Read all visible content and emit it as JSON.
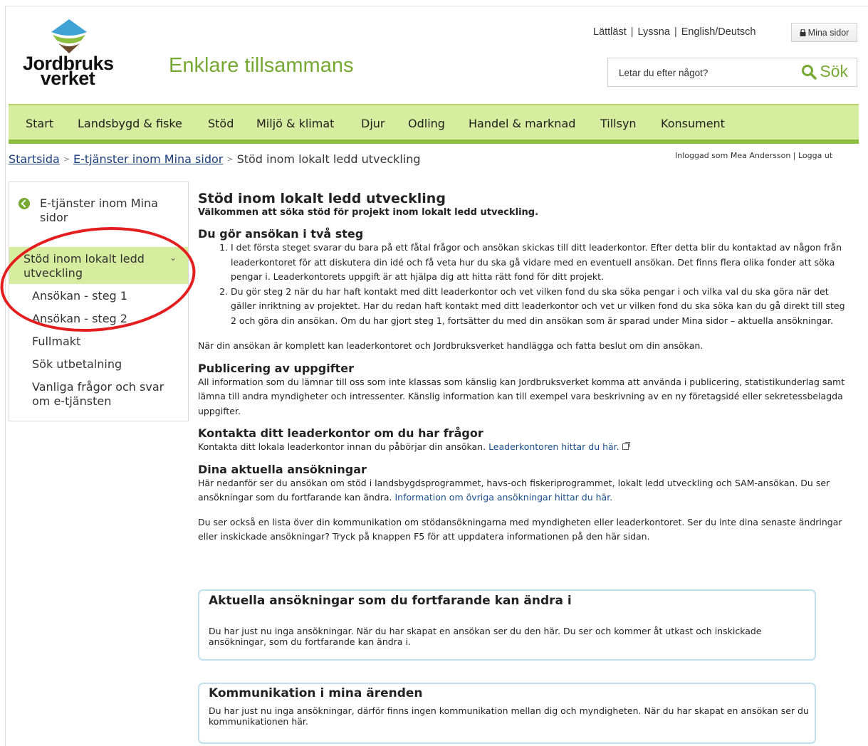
{
  "header": {
    "logo_line1": "Jordbruks",
    "logo_line2": "verket",
    "tagline": "Enklare tillsammans",
    "links": [
      "Lättläst",
      "Lyssna",
      "English/Deutsch"
    ],
    "mina_sidor_label": "Mina sidor",
    "search_placeholder": "Letar du efter något?",
    "search_button": "Sök"
  },
  "nav": [
    "Start",
    "Landsbygd & fiske",
    "Stöd",
    "Miljö & klimat",
    "Djur",
    "Odling",
    "Handel & marknad",
    "Tillsyn",
    "Konsument"
  ],
  "breadcrumb": {
    "home": "Startsida",
    "level1": "E-tjänster inom Mina sidor",
    "current": "Stöd inom lokalt ledd utveckling"
  },
  "user": {
    "logged_in_text": "Inloggad som Mea Andersson",
    "logout": "Logga ut"
  },
  "sidebar": {
    "back": "E-tjänster inom Mina sidor",
    "active": "Stöd inom lokalt ledd utveckling",
    "items": [
      "Ansökan - steg 1",
      "Ansökan - steg 2",
      "Fullmakt",
      "Sök utbetalning",
      "Vanliga frågor och svar om e-tjänsten"
    ]
  },
  "main": {
    "title": "Stöd inom lokalt ledd utveckling",
    "intro": "Välkommen att söka stöd för projekt inom lokalt ledd utveckling.",
    "steps_heading": "Du gör ansökan i två steg",
    "step1": "I det första steget svarar du bara på ett fåtal frågor och ansökan skickas till ditt leaderkontor. Efter detta blir du kontaktad av någon från leaderkontoret för att diskutera din idé och få veta hur du ska gå vidare med en eventuell ansökan. Det finns flera olika fonder att söka pengar i. Leaderkontorets uppgift är att hjälpa dig att hitta rätt fond för ditt projekt.",
    "step2": "Du gör steg 2 när du har haft kontakt med ditt leaderkontor och vet vilken fond du ska söka pengar i och vilka val du ska göra när det gäller inriktning av projektet. Har du redan haft kontakt med ditt leaderkontor och vet ur vilken fond du ska söka kan du gå direkt till steg 2 och göra din ansökan. Om du har gjort steg 1, fortsätter du med din ansökan som är sparad under Mina sidor – aktuella ansökningar.",
    "complete_text": "När din ansökan är komplett kan leaderkontoret och Jordbruksverket handlägga och fatta beslut om din ansökan.",
    "pub_heading": "Publicering av uppgifter",
    "pub_text": "All information som du lämnar till oss som inte klassas som känslig kan Jordbruksverket komma att använda i publicering, statistikunderlag samt lämna till andra myndigheter och intressenter. Känslig information kan till exempel vara beskrivning av en ny företagsidé eller sekretessbelagda uppgifter.",
    "contact_heading": "Kontakta ditt leaderkontor om du har frågor",
    "contact_text": "Kontakta ditt lokala leaderkontor innan du påbörjar din ansökan.",
    "contact_link": "Leaderkontoren hittar du här.",
    "current_heading": "Dina aktuella ansökningar",
    "current_text": "Här nedanför ser du ansökan om stöd i landsbygdsprogrammet, havs-och fiskeriprogrammet, lokalt ledd utveckling och SAM-ansökan. Du ser ansökningar som du fortfarande kan ändra.",
    "current_link": "Information om övriga ansökningar hittar du här.",
    "list_text": "Du ser också en lista över din kommunikation om stödansökningarna med myndigheten eller leaderkontoret. Ser du inte dina senaste ändringar eller inskickade ansökningar? Tryck på knappen F5 för att uppdatera informationen på den här sidan."
  },
  "box1": {
    "title": "Aktuella ansökningar som du fortfarande kan ändra i",
    "text": "Du har just nu inga ansökningar. När du har skapat en ansökan ser du den här. Du ser och kommer åt utkast och inskickade ansökningar, som du fortfarande kan ändra i."
  },
  "box2": {
    "title": "Kommunikation i mina ärenden",
    "text": "Du har just nu inga ansökningar, därför finns ingen kommunikation mellan dig och myndigheten. När du har skapat en ansökan ser du kommunikationen här."
  },
  "colors": {
    "green": "#76a833",
    "nav_bg": "#d6ec9e",
    "link": "#1a4f8a",
    "highlight": "#e41e1e"
  }
}
